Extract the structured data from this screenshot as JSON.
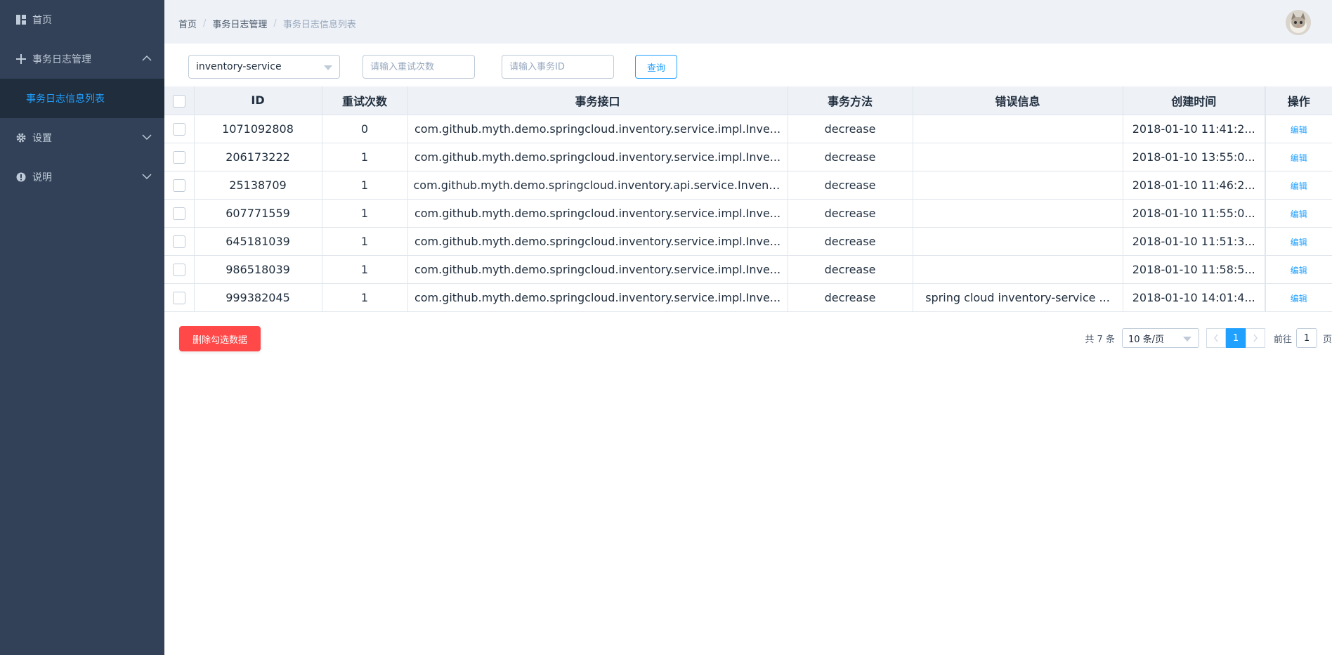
{
  "sidebar": {
    "items": [
      {
        "label": "首页",
        "icon": "dashboard-icon"
      },
      {
        "label": "事务日志管理",
        "icon": "plus-icon",
        "expanded": true,
        "children": [
          {
            "label": "事务日志信息列表",
            "active": true
          }
        ]
      },
      {
        "label": "设置",
        "icon": "gear-icon"
      },
      {
        "label": "说明",
        "icon": "info-icon"
      }
    ]
  },
  "header": {
    "breadcrumb": [
      "首页",
      "事务日志管理",
      "事务日志信息列表"
    ],
    "breadcrumb_separator": "/"
  },
  "filters": {
    "service_value": "inventory-service",
    "retry_placeholder": "请输入重试次数",
    "txid_placeholder": "请输入事务ID",
    "query_label": "查询"
  },
  "table": {
    "columns": [
      "ID",
      "重试次数",
      "事务接口",
      "事务方法",
      "错误信息",
      "创建时间",
      "操作"
    ],
    "rows": [
      {
        "id": "1071092808",
        "retry": "0",
        "iface": "com.github.myth.demo.springcloud.inventory.service.impl.Inve...",
        "method": "decrease",
        "error": "",
        "created": "2018-01-10 11:41:2...",
        "op": "编辑"
      },
      {
        "id": "206173222",
        "retry": "1",
        "iface": "com.github.myth.demo.springcloud.inventory.service.impl.Inve...",
        "method": "decrease",
        "error": "",
        "created": "2018-01-10 13:55:0...",
        "op": "编辑"
      },
      {
        "id": "25138709",
        "retry": "1",
        "iface": "com.github.myth.demo.springcloud.inventory.api.service.Invent...",
        "method": "decrease",
        "error": "",
        "created": "2018-01-10 11:46:2...",
        "op": "编辑"
      },
      {
        "id": "607771559",
        "retry": "1",
        "iface": "com.github.myth.demo.springcloud.inventory.service.impl.Inve...",
        "method": "decrease",
        "error": "",
        "created": "2018-01-10 11:55:0...",
        "op": "编辑"
      },
      {
        "id": "645181039",
        "retry": "1",
        "iface": "com.github.myth.demo.springcloud.inventory.service.impl.Inve...",
        "method": "decrease",
        "error": "",
        "created": "2018-01-10 11:51:3...",
        "op": "编辑"
      },
      {
        "id": "986518039",
        "retry": "1",
        "iface": "com.github.myth.demo.springcloud.inventory.service.impl.Inve...",
        "method": "decrease",
        "error": "",
        "created": "2018-01-10 11:58:5...",
        "op": "编辑"
      },
      {
        "id": "999382045",
        "retry": "1",
        "iface": "com.github.myth.demo.springcloud.inventory.service.impl.Inve...",
        "method": "decrease",
        "error": "spring cloud inventory-service ...",
        "created": "2018-01-10 14:01:4...",
        "op": "编辑"
      }
    ]
  },
  "footer": {
    "delete_label": "删除勾选数据",
    "total_text": "共 7 条",
    "page_size": "10 条/页",
    "current_page": "1",
    "jump_label": "前往",
    "jump_value": "1",
    "jump_suffix": "页"
  },
  "colors": {
    "sidebar_bg": "#324157",
    "accent": "#20a0ff",
    "danger": "#ff4949",
    "header_bg": "#eef1f6"
  }
}
